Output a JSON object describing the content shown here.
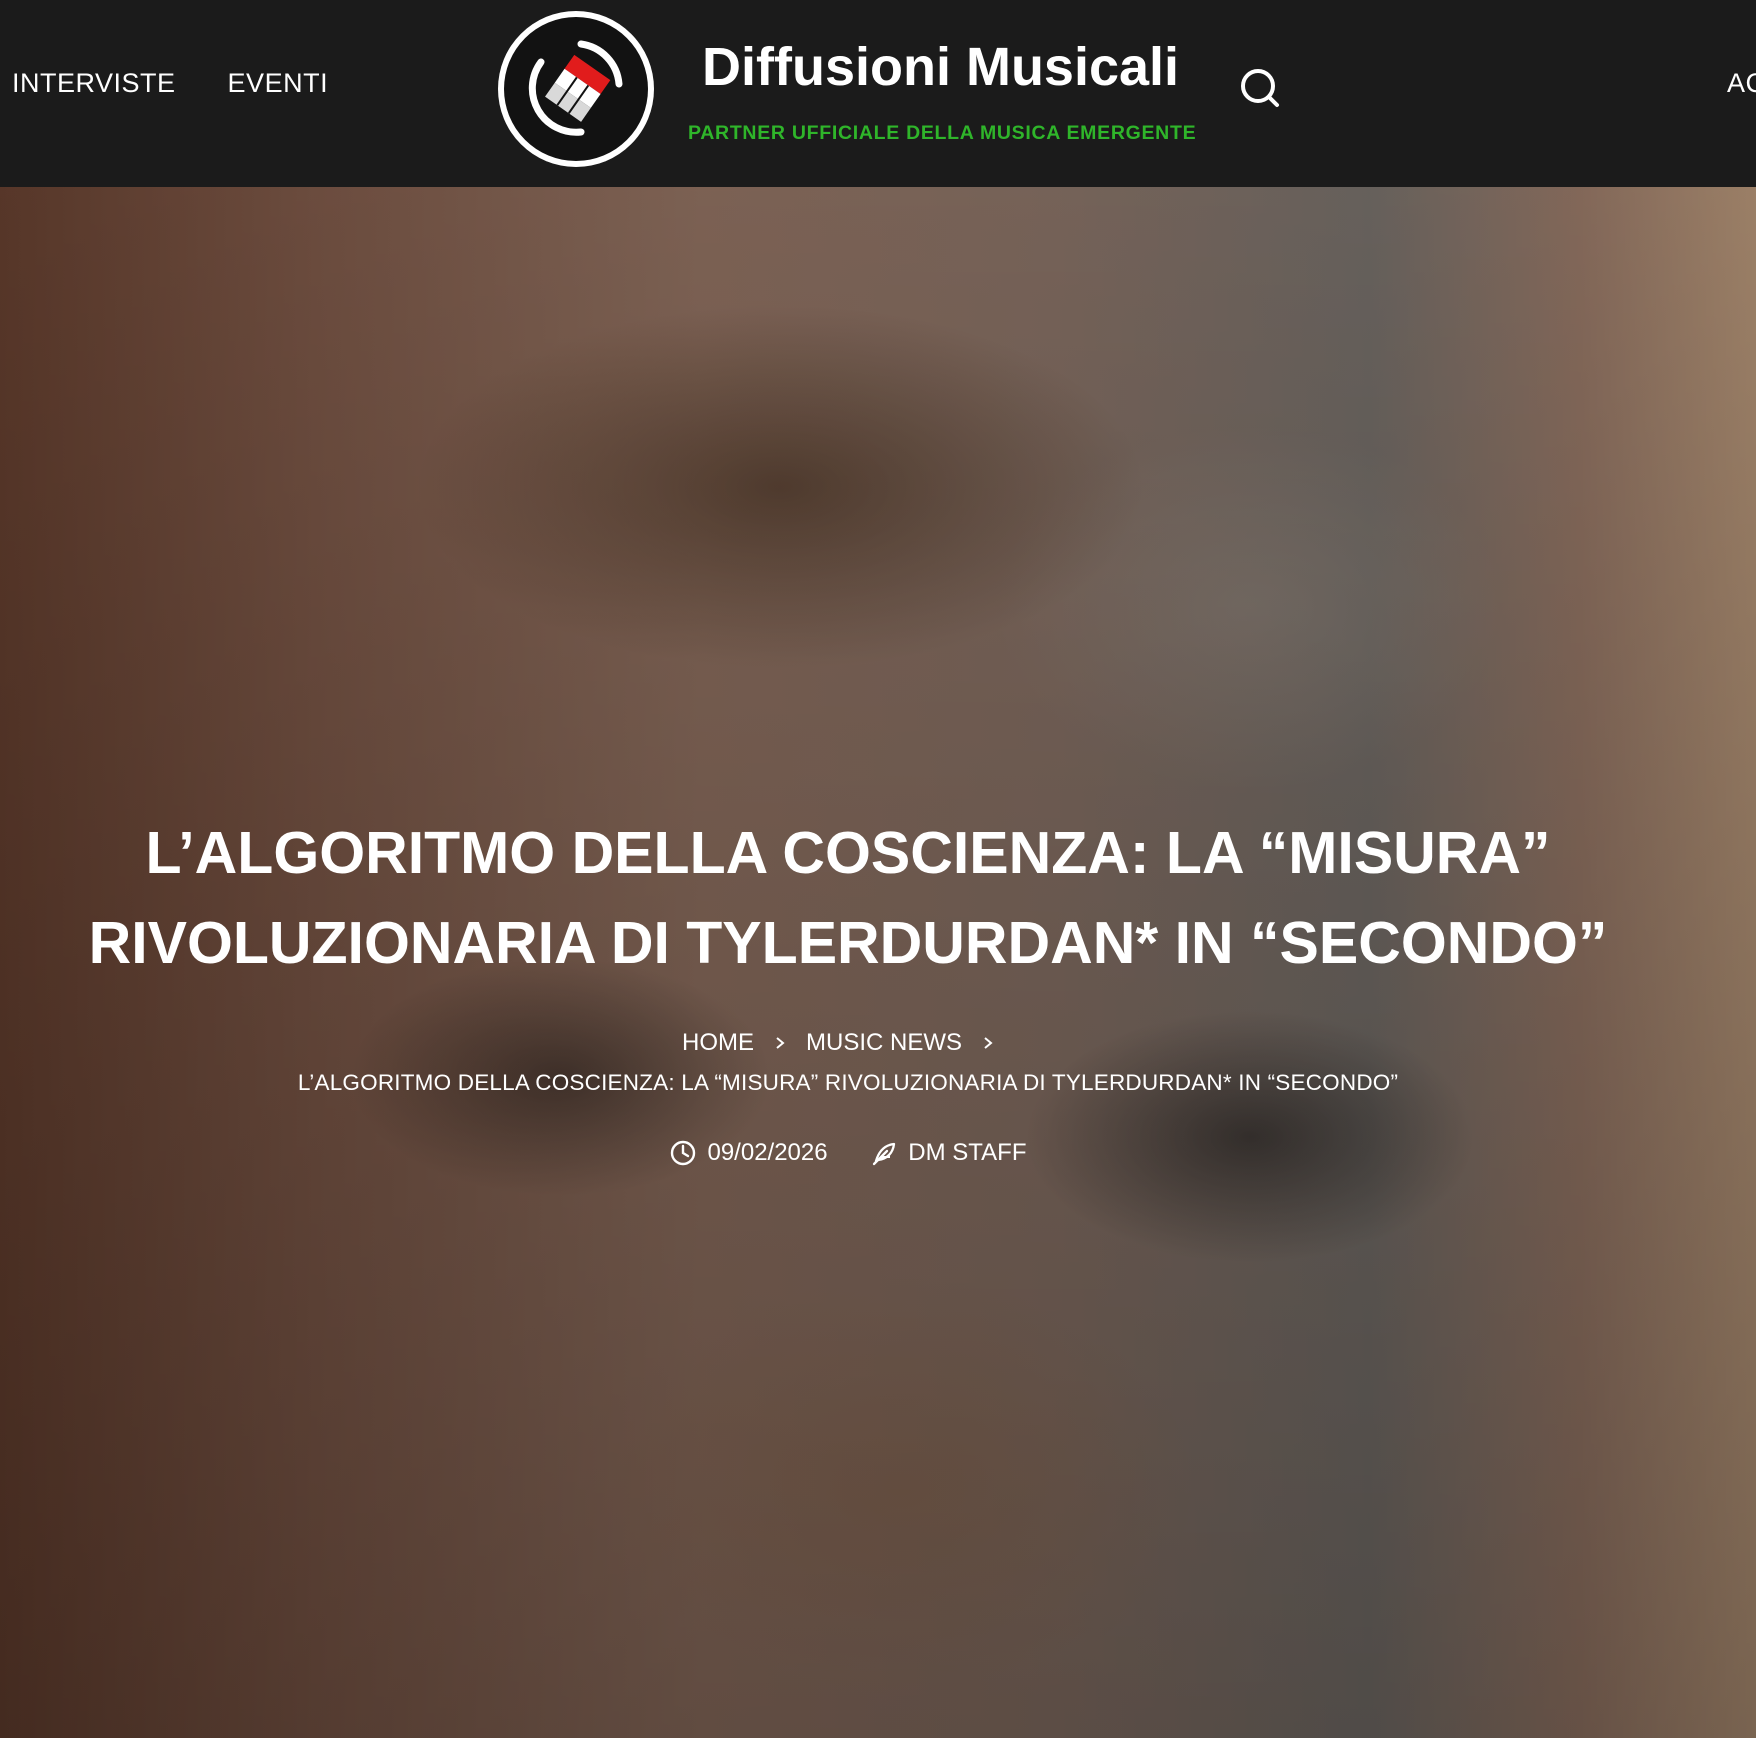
{
  "header": {
    "nav_left": [
      "INTERVISTE",
      "EVENTI"
    ],
    "nav_right_partial": "AC",
    "brand_title": "Diffusioni Musicali",
    "tagline": "PARTNER UFFICIALE DELLA MUSICA EMERGENTE",
    "logo_icon": "vinyl-flag-logo-icon",
    "search_icon": "search-icon"
  },
  "post": {
    "title_line1": "L’ALGORITMO DELLA COSCIENZA: LA “MISURA”",
    "title_line2": "RIVOLUZIONARIA DI TYLERDURDAN* IN “SECONDO”",
    "breadcrumb": {
      "home": "HOME",
      "category": "MUSIC NEWS",
      "current": "L’ALGORITMO DELLA COSCIENZA: LA “MISURA” RIVOLUZIONARIA DI TYLERDURDAN* IN “SECONDO”"
    },
    "date": "09/02/2026",
    "author": "DM STAFF"
  },
  "colors": {
    "header_bg": "#1b1b1b",
    "tagline_green": "#2fb52a",
    "text_white": "#ffffff"
  }
}
